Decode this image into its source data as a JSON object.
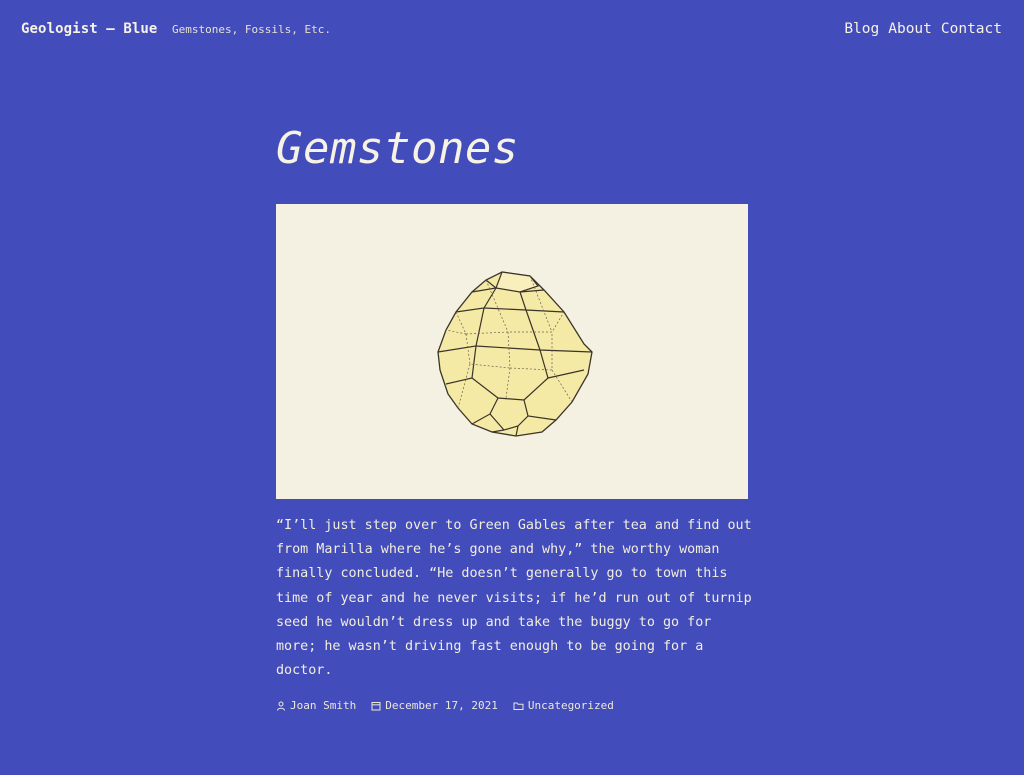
{
  "header": {
    "site_title": "Geologist – Blue",
    "tagline": "Gemstones, Fossils, Etc.",
    "nav": [
      {
        "label": "Blog"
      },
      {
        "label": "About"
      },
      {
        "label": "Contact"
      }
    ]
  },
  "post": {
    "title": "Gemstones",
    "image_subject": "gemstone-crystal-illustration",
    "excerpt": "“I’ll just step over to Green Gables after tea and find out from Marilla where he’s gone and why,” the worthy woman finally concluded. “He doesn’t generally go to town this time of year and he never visits; if he’d run out of turnip seed he wouldn’t dress up and take the buggy to go for more; he wasn’t driving fast enough to be going for a doctor.",
    "meta": {
      "author": "Joan Smith",
      "date": "December 17, 2021",
      "category": "Uncategorized",
      "author_icon": "person-icon",
      "date_icon": "calendar-icon",
      "category_icon": "folder-icon"
    }
  },
  "colors": {
    "background": "#434cbb",
    "text": "#f2eedd",
    "image_background": "#f4f0e2",
    "gem_fill": "#f5e9a6"
  }
}
